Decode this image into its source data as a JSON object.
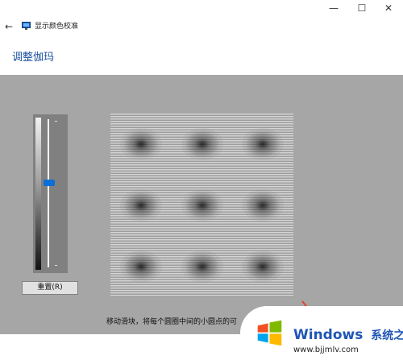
{
  "window": {
    "title": "显示颜色校准",
    "back_icon": "←",
    "minimize_icon": "—",
    "maximize_icon": "☐",
    "close_icon": "✕"
  },
  "page": {
    "heading": "调整伽玛"
  },
  "gamma_control": {
    "reset_label": "重置(R)",
    "slider_level": 0.57
  },
  "test_pattern": {
    "rows": 3,
    "columns": 3
  },
  "instruction": "移动滑块，将每个圆圈中间的小圆点的可",
  "watermark": {
    "brand_en": "Windows",
    "brand_cn": "系统之家",
    "url": "www.bjjmlv.com"
  },
  "colors": {
    "heading": "#1a4fa0",
    "slider_thumb": "#0a6fd6",
    "annotation_arrow": "#e8402e"
  }
}
